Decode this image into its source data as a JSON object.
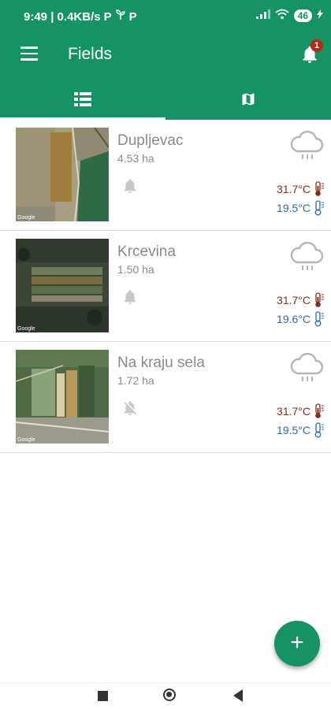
{
  "status_bar": {
    "time_speed": "9:49 | 0.4KB/s",
    "battery": "46"
  },
  "app_bar": {
    "title": "Fields",
    "notification_count": "1"
  },
  "tabs": [
    {
      "icon": "list-icon",
      "active": true
    },
    {
      "icon": "map-icon",
      "active": false
    }
  ],
  "fields": [
    {
      "name": "Dupljevac",
      "area": "4.53 ha",
      "temp_max": "31.7°C",
      "temp_min": "19.5°C",
      "notifications": "on"
    },
    {
      "name": "Krcevina",
      "area": "1.50 ha",
      "temp_max": "31.7°C",
      "temp_min": "19.6°C",
      "notifications": "on"
    },
    {
      "name": "Na kraju sela",
      "area": "1.72 ha",
      "temp_max": "31.7°C",
      "temp_min": "19.5°C",
      "notifications": "off"
    }
  ],
  "thumb_attribution": "Google",
  "colors": {
    "primary": "#159364",
    "temp_max": "#8b2b16",
    "temp_min": "#2a6aa8",
    "badge": "#b8290f"
  },
  "fab": {
    "label": "+"
  }
}
